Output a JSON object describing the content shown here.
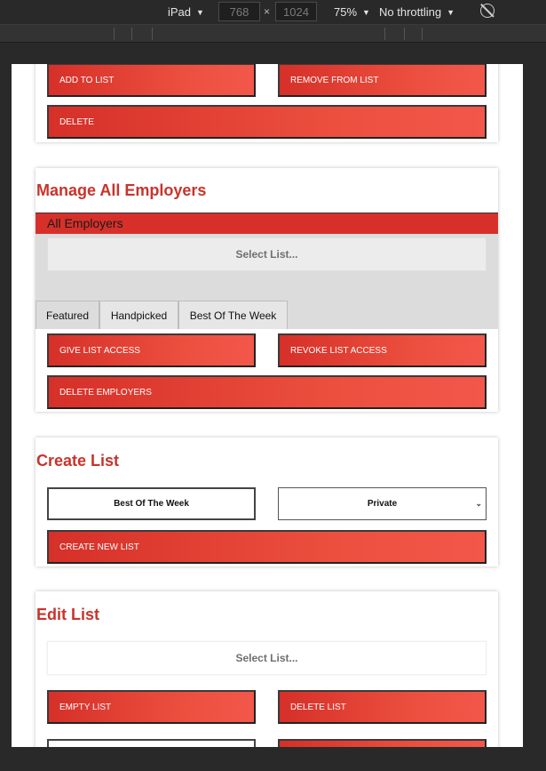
{
  "devtools": {
    "device": "iPad",
    "width": "768",
    "height": "1024",
    "times": "×",
    "zoom": "75%",
    "throttling": "No throttling",
    "caret": "▼"
  },
  "top_card": {
    "add_to_list": "ADD TO LIST",
    "remove_from_list": "REMOVE FROM LIST",
    "delete": "DELETE"
  },
  "manage_all": {
    "title": "Manage All Employers",
    "bar_label": "All Employers",
    "select_placeholder": "Select List...",
    "tabs": [
      "Featured",
      "Handpicked",
      "Best Of The Week"
    ],
    "give_access": "GIVE LIST ACCESS",
    "revoke_access": "REVOKE LIST ACCESS",
    "delete_employers": "DELETE EMPLOYERS"
  },
  "create_list": {
    "title": "Create List",
    "name_value": "Best Of The Week",
    "privacy_value": "Private",
    "create_button": "CREATE NEW LIST"
  },
  "edit_list": {
    "title": "Edit List",
    "select_placeholder": "Select List...",
    "empty_list": "EMPTY LIST",
    "delete_list": "DELETE LIST"
  },
  "colors": {
    "accent": "#d7302a",
    "title": "#c8342c"
  }
}
